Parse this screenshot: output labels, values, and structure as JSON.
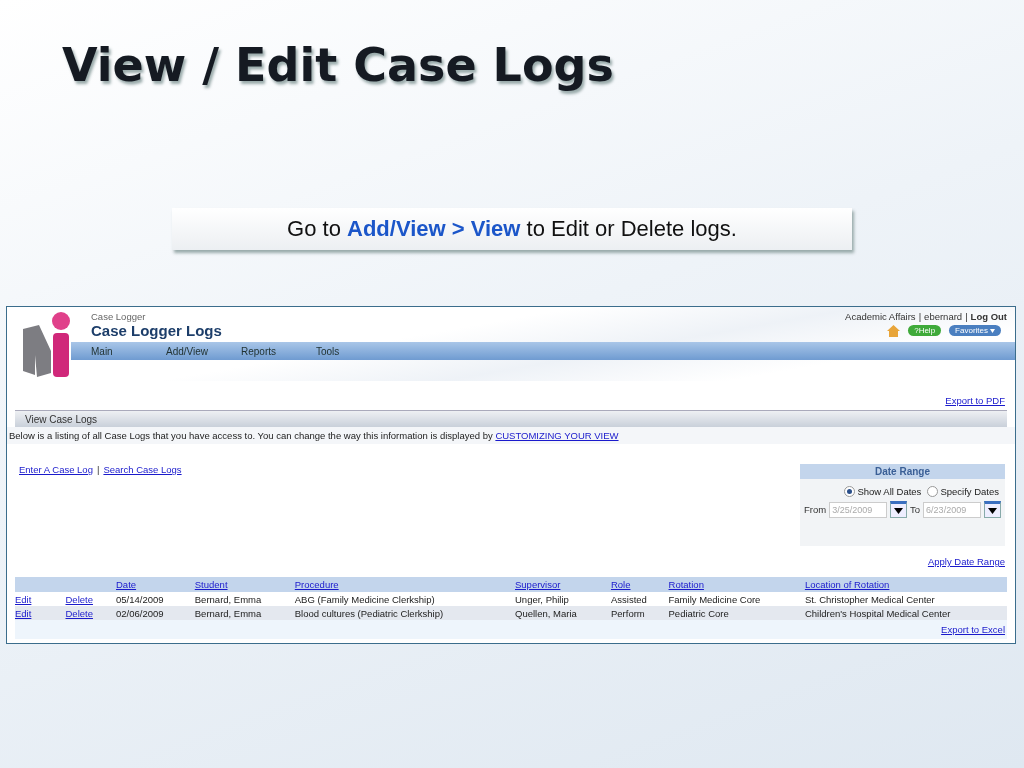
{
  "slide": {
    "title": "View / Edit Case Logs",
    "callout": "Go to **Add/View > View** to Edit or Delete logs."
  },
  "app": {
    "module": "Case Logger",
    "title": "Case Logger Logs",
    "user_bar": {
      "department": "Academic Affairs",
      "separator": "|",
      "username": "ebernard",
      "logout": "Log Out"
    },
    "help": "?Help",
    "favorites": "Favorites",
    "nav": [
      "Main",
      "Add/View",
      "Reports",
      "Tools"
    ],
    "export_pdf": "Export to PDF",
    "section_title": "View Case Logs",
    "description": "Below is a listing of all Case Logs that you have access to. You can change the way this information is displayed by ",
    "description_link": "CUSTOMIZING YOUR VIEW",
    "links": [
      {
        "label": "Enter A Case Log"
      },
      {
        "label": "Search Case Logs"
      }
    ],
    "link_separator": "|",
    "date_range": {
      "title": "Date Range",
      "options": [
        {
          "label": "Show All Dates",
          "selected": true
        },
        {
          "label": "Specify Dates",
          "selected": false
        }
      ],
      "from_label": "From",
      "from_value": "3/25/2009",
      "to_label": "To",
      "to_value": "6/23/2009",
      "disabled": true
    },
    "apply": "Apply Date Range",
    "table": {
      "columns": [
        "Date",
        "Student",
        "Procedure",
        "Supervisor",
        "Role",
        "Rotation",
        "Location of Rotation"
      ],
      "rows": [
        {
          "actions": [
            "Edit",
            "Delete"
          ],
          "cells": [
            "05/14/2009",
            "Bernard, Emma",
            "ABG (Family Medicine Clerkship)",
            "Unger, Philip",
            "Assisted",
            "Family Medicine Core",
            "St. Christopher Medical Center"
          ]
        },
        {
          "actions": [
            "Edit",
            "Delete"
          ],
          "cells": [
            "02/06/2009",
            "Bernard, Emma",
            "Blood cultures (Pediatric Clerkship)",
            "Quellen, Maria",
            "Perform",
            "Pediatric Core",
            "Children's Hospital Medical Center"
          ]
        }
      ]
    },
    "export_excel": "Export to Excel"
  }
}
